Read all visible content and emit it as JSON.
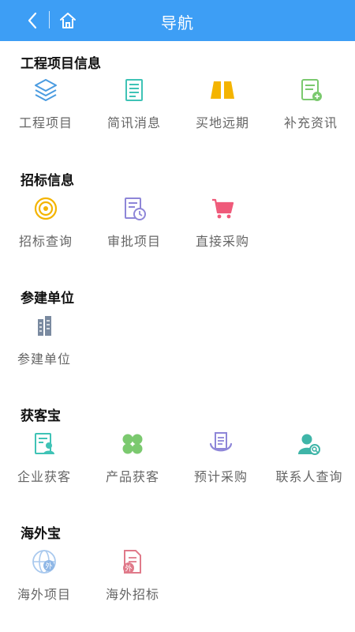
{
  "header": {
    "title": "导航"
  },
  "sections": [
    {
      "title": "工程项目信息",
      "items": [
        {
          "label": "工程项目",
          "icon": "layers-icon"
        },
        {
          "label": "简讯消息",
          "icon": "newspaper-icon"
        },
        {
          "label": "买地远期",
          "icon": "land-block-icon"
        },
        {
          "label": "补充资讯",
          "icon": "document-add-icon"
        }
      ]
    },
    {
      "title": "招标信息",
      "items": [
        {
          "label": "招标查询",
          "icon": "target-icon"
        },
        {
          "label": "审批项目",
          "icon": "document-clock-icon"
        },
        {
          "label": "直接采购",
          "icon": "cart-icon"
        }
      ]
    },
    {
      "title": "参建单位",
      "items": [
        {
          "label": "参建单位",
          "icon": "building-icon"
        }
      ]
    },
    {
      "title": "获客宝",
      "items": [
        {
          "label": "企业获客",
          "icon": "company-customer-icon"
        },
        {
          "label": "产品获客",
          "icon": "clover-icon"
        },
        {
          "label": "预计采购",
          "icon": "purchase-plan-icon"
        },
        {
          "label": "联系人查询",
          "icon": "contact-search-icon"
        }
      ]
    },
    {
      "title": "海外宝",
      "items": [
        {
          "label": "海外项目",
          "icon": "globe-icon"
        },
        {
          "label": "海外招标",
          "icon": "overseas-doc-icon"
        }
      ]
    }
  ],
  "colors": {
    "header": "#3d9ef5",
    "blue": "#4a9be0",
    "teal": "#3fc3b6",
    "yellow": "#f4b400",
    "green": "#7bc96f",
    "purple": "#8e86d8",
    "red": "#ef5a7a",
    "slate": "#7a8aa0"
  }
}
